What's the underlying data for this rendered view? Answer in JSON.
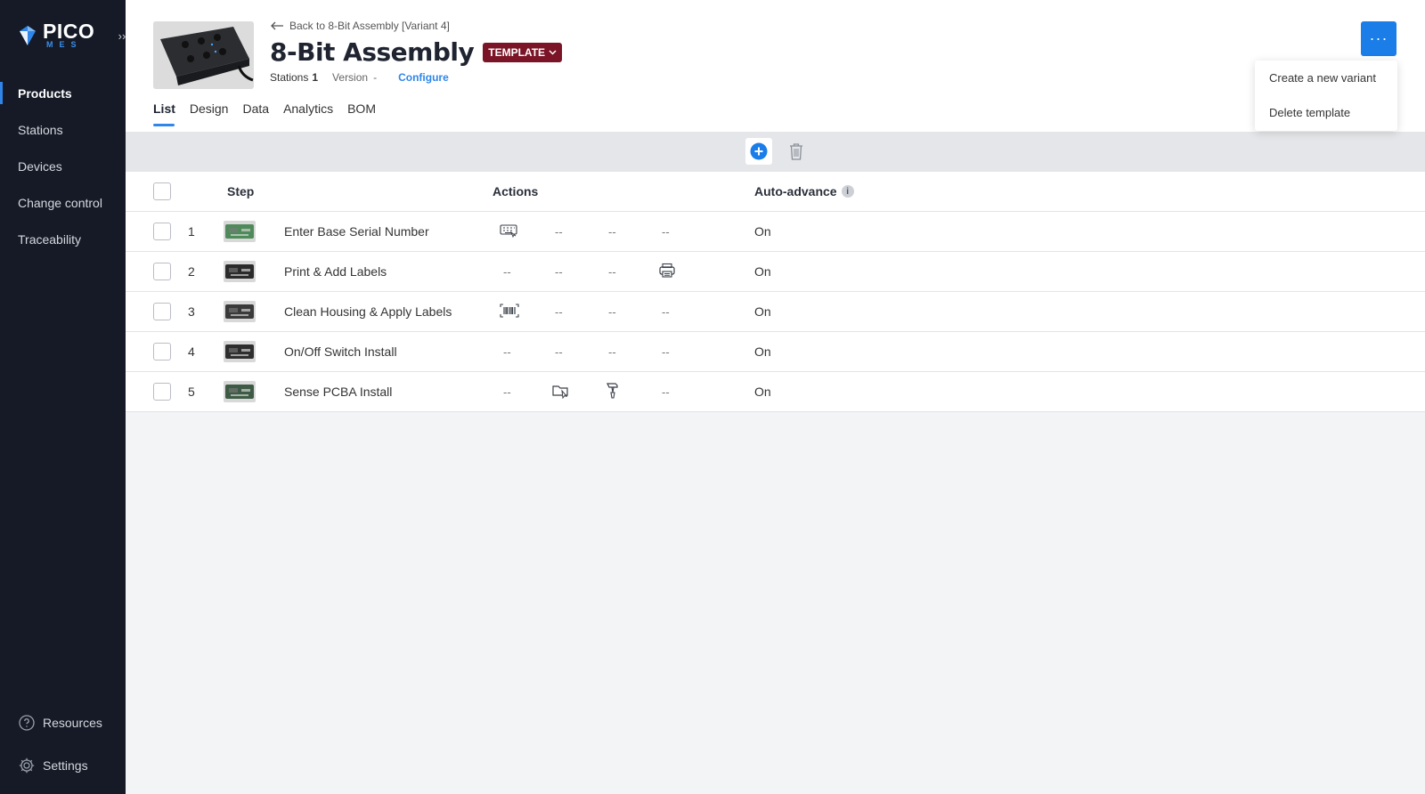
{
  "brand": {
    "name": "PICO",
    "sub": "MES",
    "accent": "#2f86e8"
  },
  "sidebar": {
    "items": [
      {
        "label": "Products",
        "active": true
      },
      {
        "label": "Stations",
        "active": false
      },
      {
        "label": "Devices",
        "active": false
      },
      {
        "label": "Change control",
        "active": false
      },
      {
        "label": "Traceability",
        "active": false
      }
    ],
    "bottom": [
      {
        "label": "Resources",
        "icon": "help-circle-icon"
      },
      {
        "label": "Settings",
        "icon": "gear-icon"
      }
    ],
    "collapse_glyph": "››"
  },
  "header": {
    "back_label": "Back to 8-Bit Assembly [Variant 4]",
    "title": "8-Bit Assembly",
    "badge": "TEMPLATE",
    "stations_label": "Stations",
    "stations_value": "1",
    "version_label": "Version",
    "version_value": "-",
    "configure_label": "Configure",
    "more_glyph": "···"
  },
  "tabs": [
    {
      "label": "List",
      "active": true
    },
    {
      "label": "Design",
      "active": false
    },
    {
      "label": "Data",
      "active": false
    },
    {
      "label": "Analytics",
      "active": false
    },
    {
      "label": "BOM",
      "active": false
    }
  ],
  "menu": {
    "items": [
      "Create a new variant",
      "Delete template"
    ]
  },
  "table": {
    "headers": {
      "step": "Step",
      "actions": "Actions",
      "auto_advance": "Auto-advance",
      "info": "i"
    },
    "dash": "--",
    "rows": [
      {
        "num": "1",
        "name": "Enter Base Serial Number",
        "actions": [
          "keyboard-icon",
          "--",
          "--",
          "--"
        ],
        "auto": "On",
        "thumb": "#4f8a5a"
      },
      {
        "num": "2",
        "name": "Print & Add Labels",
        "actions": [
          "--",
          "--",
          "--",
          "printer-icon"
        ],
        "auto": "On",
        "thumb": "#2b2b2b"
      },
      {
        "num": "3",
        "name": "Clean Housing & Apply Labels",
        "actions": [
          "barcode-icon",
          "--",
          "--",
          "--"
        ],
        "auto": "On",
        "thumb": "#3a3a3a"
      },
      {
        "num": "4",
        "name": "On/Off Switch Install",
        "actions": [
          "--",
          "--",
          "--",
          "--"
        ],
        "auto": "On",
        "thumb": "#2e2e2e"
      },
      {
        "num": "5",
        "name": "Sense PCBA Install",
        "actions": [
          "--",
          "pick-part-icon",
          "screwdriver-icon",
          "--"
        ],
        "auto": "On",
        "thumb": "#3d5a44"
      }
    ]
  }
}
